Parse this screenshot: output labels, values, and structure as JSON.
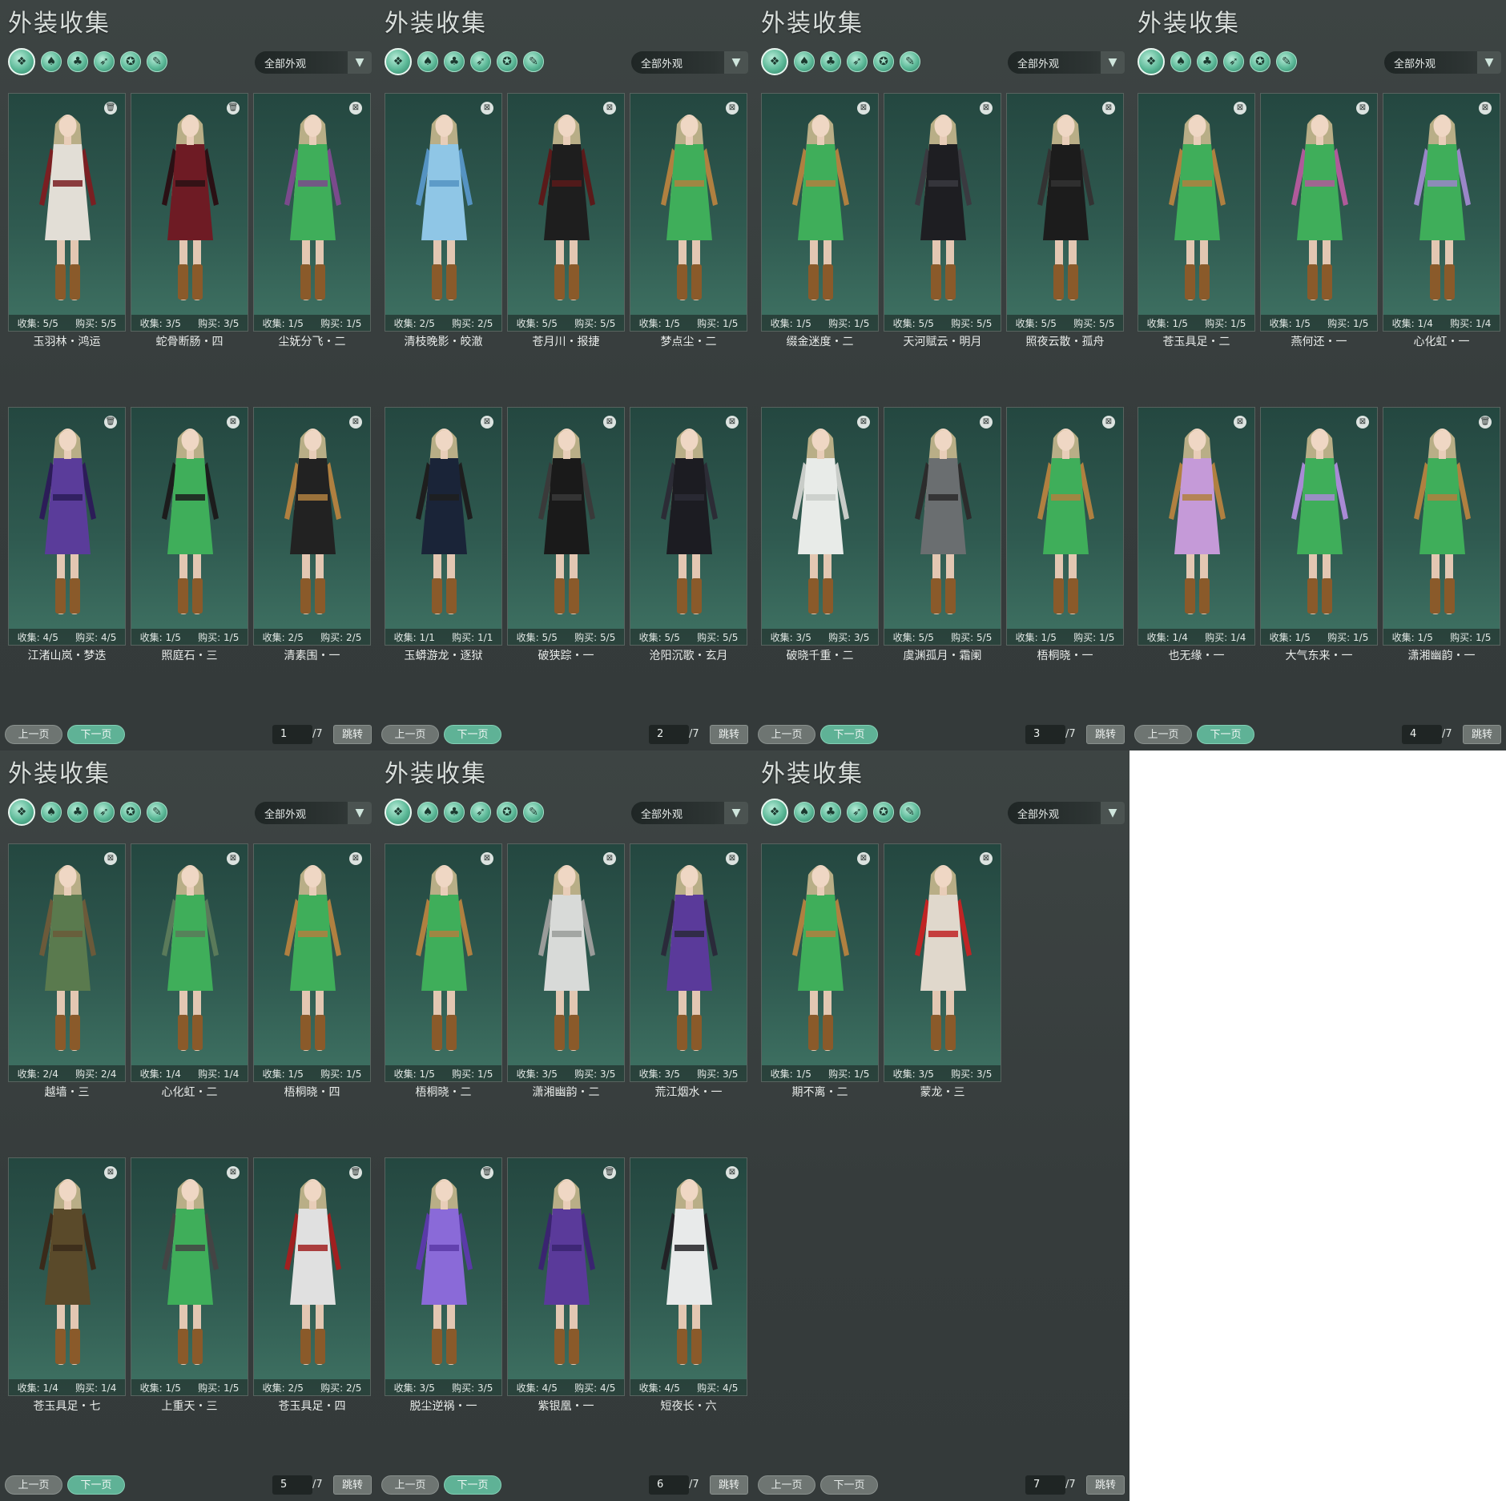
{
  "colors": {
    "accent": "#5fb296",
    "panel_bg": "#363c3c",
    "card_bg": "#2f5a50"
  },
  "panels": [
    {
      "title": "外装收集",
      "filter": "全部外观",
      "category_icons": [
        "all-outfits-icon",
        "robe-icon",
        "garment-icon",
        "wing-icon",
        "mask-icon",
        "scroll-icon"
      ],
      "items": [
        {
          "name": "玉羽林・鸿运",
          "collect": "收集: 5/5",
          "buy": "购买: 5/5",
          "badge": "trash-icon",
          "c1": "#e2ded6",
          "c2": "#7a1f22"
        },
        {
          "name": "蛇骨断肠・四",
          "collect": "收集: 3/5",
          "buy": "购买: 3/5",
          "badge": "trash-icon",
          "c1": "#6e1b24",
          "c2": "#2a1014"
        },
        {
          "name": "尘妩分飞・二",
          "collect": "收集: 1/5",
          "buy": "购买: 1/5",
          "badge": "lock-icon",
          "c1": "#3fae5a",
          "c2": "#7b4a8c"
        },
        {
          "name": "江渚山岚・梦迭",
          "collect": "收集: 4/5",
          "buy": "购买: 4/5",
          "badge": "trash-icon",
          "c1": "#5a3c9a",
          "c2": "#2c1c58"
        },
        {
          "name": "照庭石・三",
          "collect": "收集: 1/5",
          "buy": "购买: 1/5",
          "badge": "lock-icon",
          "c1": "#3fae5a",
          "c2": "#1c1c1c"
        },
        {
          "name": "清素围・一",
          "collect": "收集: 2/5",
          "buy": "购买: 2/5",
          "badge": "lock-icon",
          "c1": "#222222",
          "c2": "#b08040"
        }
      ],
      "pagination": {
        "prev": "上一页",
        "next": "下一页",
        "page": "1",
        "total": "/7",
        "jump": "跳转"
      }
    },
    {
      "title": "外装收集",
      "filter": "全部外观",
      "category_icons": [
        "all-outfits-icon",
        "robe-icon",
        "garment-icon",
        "wing-icon",
        "mask-icon",
        "scroll-icon"
      ],
      "items": [
        {
          "name": "清枝晚影・皎澈",
          "collect": "收集: 2/5",
          "buy": "购买: 2/5",
          "badge": "lock-icon",
          "c1": "#8fc6e6",
          "c2": "#5593c2"
        },
        {
          "name": "苍月川・报捷",
          "collect": "收集: 5/5",
          "buy": "购买: 5/5",
          "badge": "lock-icon",
          "c1": "#1e1e1e",
          "c2": "#5a1a1a"
        },
        {
          "name": "梦点尘・二",
          "collect": "收集: 1/5",
          "buy": "购买: 1/5",
          "badge": "lock-icon",
          "c1": "#3fae5a",
          "c2": "#b08040"
        },
        {
          "name": "玉蟒游龙・逐狱",
          "collect": "收集: 1/1",
          "buy": "购买: 1/1",
          "badge": "lock-icon",
          "c1": "#1a2438",
          "c2": "#1e1e1e"
        },
        {
          "name": "破狭踪・一",
          "collect": "收集: 5/5",
          "buy": "购买: 5/5",
          "badge": "lock-icon",
          "c1": "#1a1a1a",
          "c2": "#3a3a3a"
        },
        {
          "name": "沧阳沉歌・玄月",
          "collect": "收集: 5/5",
          "buy": "购买: 5/5",
          "badge": "lock-icon",
          "c1": "#1c1c22",
          "c2": "#2c2c36"
        }
      ],
      "pagination": {
        "prev": "上一页",
        "next": "下一页",
        "page": "2",
        "total": "/7",
        "jump": "跳转"
      }
    },
    {
      "title": "外装收集",
      "filter": "全部外观",
      "category_icons": [
        "all-outfits-icon",
        "robe-icon",
        "garment-icon",
        "wing-icon",
        "mask-icon",
        "scroll-icon"
      ],
      "items": [
        {
          "name": "缀金迷度・二",
          "collect": "收集: 1/5",
          "buy": "购买: 1/5",
          "badge": "lock-icon",
          "c1": "#3fae5a",
          "c2": "#b08040"
        },
        {
          "name": "天河赋云・明月",
          "collect": "收集: 5/5",
          "buy": "购买: 5/5",
          "badge": "lock-icon",
          "c1": "#1e1e22",
          "c2": "#3a3a40"
        },
        {
          "name": "照夜云散・孤舟",
          "collect": "收集: 5/5",
          "buy": "购买: 5/5",
          "badge": "lock-icon",
          "c1": "#1c1c1c",
          "c2": "#333333"
        },
        {
          "name": "破晓千重・二",
          "collect": "收集: 3/5",
          "buy": "购买: 3/5",
          "badge": "lock-icon",
          "c1": "#e8ebe8",
          "c2": "#c8ccc8"
        },
        {
          "name": "虞渊孤月・霜阑",
          "collect": "收集: 5/5",
          "buy": "购买: 5/5",
          "badge": "lock-icon",
          "c1": "#6a6e70",
          "c2": "#2c2c2c"
        },
        {
          "name": "梧桐晓・一",
          "collect": "收集: 1/5",
          "buy": "购买: 1/5",
          "badge": "lock-icon",
          "c1": "#3fae5a",
          "c2": "#b08040"
        }
      ],
      "pagination": {
        "prev": "上一页",
        "next": "下一页",
        "page": "3",
        "total": "/7",
        "jump": "跳转"
      }
    },
    {
      "title": "外装收集",
      "filter": "全部外观",
      "category_icons": [
        "all-outfits-icon",
        "robe-icon",
        "garment-icon",
        "wing-icon",
        "mask-icon",
        "scroll-icon"
      ],
      "items": [
        {
          "name": "苍玉具足・二",
          "collect": "收集: 1/5",
          "buy": "购买: 1/5",
          "badge": "lock-icon",
          "c1": "#3fae5a",
          "c2": "#b08040"
        },
        {
          "name": "燕何还・一",
          "collect": "收集: 1/5",
          "buy": "购买: 1/5",
          "badge": "lock-icon",
          "c1": "#3fae5a",
          "c2": "#b05a9a"
        },
        {
          "name": "心化虹・一",
          "collect": "收集: 1/4",
          "buy": "购买: 1/4",
          "badge": "lock-icon",
          "c1": "#3fae5a",
          "c2": "#9a86c8"
        },
        {
          "name": "也无缘・一",
          "collect": "收集: 1/4",
          "buy": "购买: 1/4",
          "badge": "lock-icon",
          "c1": "#c59ad8",
          "c2": "#b08040"
        },
        {
          "name": "大气东来・一",
          "collect": "收集: 1/5",
          "buy": "购买: 1/5",
          "badge": "lock-icon",
          "c1": "#3fae5a",
          "c2": "#a98ad6"
        },
        {
          "name": "潇湘幽韵・一",
          "collect": "收集: 1/5",
          "buy": "购买: 1/5",
          "badge": "trash-icon",
          "c1": "#3fae5a",
          "c2": "#b08040"
        }
      ],
      "pagination": {
        "prev": "上一页",
        "next": "下一页",
        "page": "4",
        "total": "/7",
        "jump": "跳转"
      }
    },
    {
      "title": "外装收集",
      "filter": "全部外观",
      "category_icons": [
        "all-outfits-icon",
        "robe-icon",
        "garment-icon",
        "wing-icon",
        "mask-icon",
        "scroll-icon"
      ],
      "items": [
        {
          "name": "越墙・三",
          "collect": "收集: 2/4",
          "buy": "购买: 2/4",
          "badge": "lock-icon",
          "c1": "#5a7a4e",
          "c2": "#6b5a3a"
        },
        {
          "name": "心化虹・二",
          "collect": "收集: 1/4",
          "buy": "购买: 1/4",
          "badge": "lock-icon",
          "c1": "#3fae5a",
          "c2": "#5a7a5a"
        },
        {
          "name": "梧桐晓・四",
          "collect": "收集: 1/5",
          "buy": "购买: 1/5",
          "badge": "lock-icon",
          "c1": "#3fae5a",
          "c2": "#b08040"
        },
        {
          "name": "苍玉具足・七",
          "collect": "收集: 1/4",
          "buy": "购买: 1/4",
          "badge": "lock-icon",
          "c1": "#5a4a2a",
          "c2": "#3a2a1a"
        },
        {
          "name": "上重天・三",
          "collect": "收集: 1/5",
          "buy": "购买: 1/5",
          "badge": "lock-icon",
          "c1": "#3fae5a",
          "c2": "#444444"
        },
        {
          "name": "苍玉具足・四",
          "collect": "收集: 2/5",
          "buy": "购买: 2/5",
          "badge": "trash-icon",
          "c1": "#e0e0e0",
          "c2": "#a02020"
        }
      ],
      "pagination": {
        "prev": "上一页",
        "next": "下一页",
        "page": "5",
        "total": "/7",
        "jump": "跳转"
      }
    },
    {
      "title": "外装收集",
      "filter": "全部外观",
      "category_icons": [
        "all-outfits-icon",
        "robe-icon",
        "garment-icon",
        "wing-icon",
        "mask-icon",
        "scroll-icon"
      ],
      "items": [
        {
          "name": "梧桐晓・二",
          "collect": "收集: 1/5",
          "buy": "购买: 1/5",
          "badge": "lock-icon",
          "c1": "#3fae5a",
          "c2": "#b08040"
        },
        {
          "name": "潇湘幽韵・二",
          "collect": "收集: 3/5",
          "buy": "购买: 3/5",
          "badge": "lock-icon",
          "c1": "#d8dad8",
          "c2": "#9a9c9a"
        },
        {
          "name": "荒江烟水・一",
          "collect": "收集: 3/5",
          "buy": "购买: 3/5",
          "badge": "lock-icon",
          "c1": "#5a3a9a",
          "c2": "#2a2a3a"
        },
        {
          "name": "脱尘逆祸・一",
          "collect": "收集: 3/5",
          "buy": "购买: 3/5",
          "badge": "trash-icon",
          "c1": "#8a6ad8",
          "c2": "#5a3aa8"
        },
        {
          "name": "紫银凰・一",
          "collect": "收集: 4/5",
          "buy": "购买: 4/5",
          "badge": "trash-icon",
          "c1": "#5a3a9a",
          "c2": "#3a2470"
        },
        {
          "name": "短夜长・六",
          "collect": "收集: 4/5",
          "buy": "购买: 4/5",
          "badge": "lock-icon",
          "c1": "#e8eaea",
          "c2": "#222226"
        }
      ],
      "pagination": {
        "prev": "上一页",
        "next": "下一页",
        "page": "6",
        "total": "/7",
        "jump": "跳转"
      }
    },
    {
      "title": "外装收集",
      "filter": "全部外观",
      "category_icons": [
        "all-outfits-icon",
        "robe-icon",
        "garment-icon",
        "wing-icon",
        "mask-icon",
        "scroll-icon"
      ],
      "items": [
        {
          "name": "期不离・二",
          "collect": "收集: 1/5",
          "buy": "购买: 1/5",
          "badge": "lock-icon",
          "c1": "#3fae5a",
          "c2": "#b08040"
        },
        {
          "name": "蒙龙・三",
          "collect": "收集: 3/5",
          "buy": "购买: 3/5",
          "badge": "lock-icon",
          "c1": "#e0d8cc",
          "c2": "#c02424"
        }
      ],
      "pagination": {
        "prev": "上一页",
        "next": "下一页",
        "page": "7",
        "total": "/7",
        "jump": "跳转"
      }
    }
  ]
}
